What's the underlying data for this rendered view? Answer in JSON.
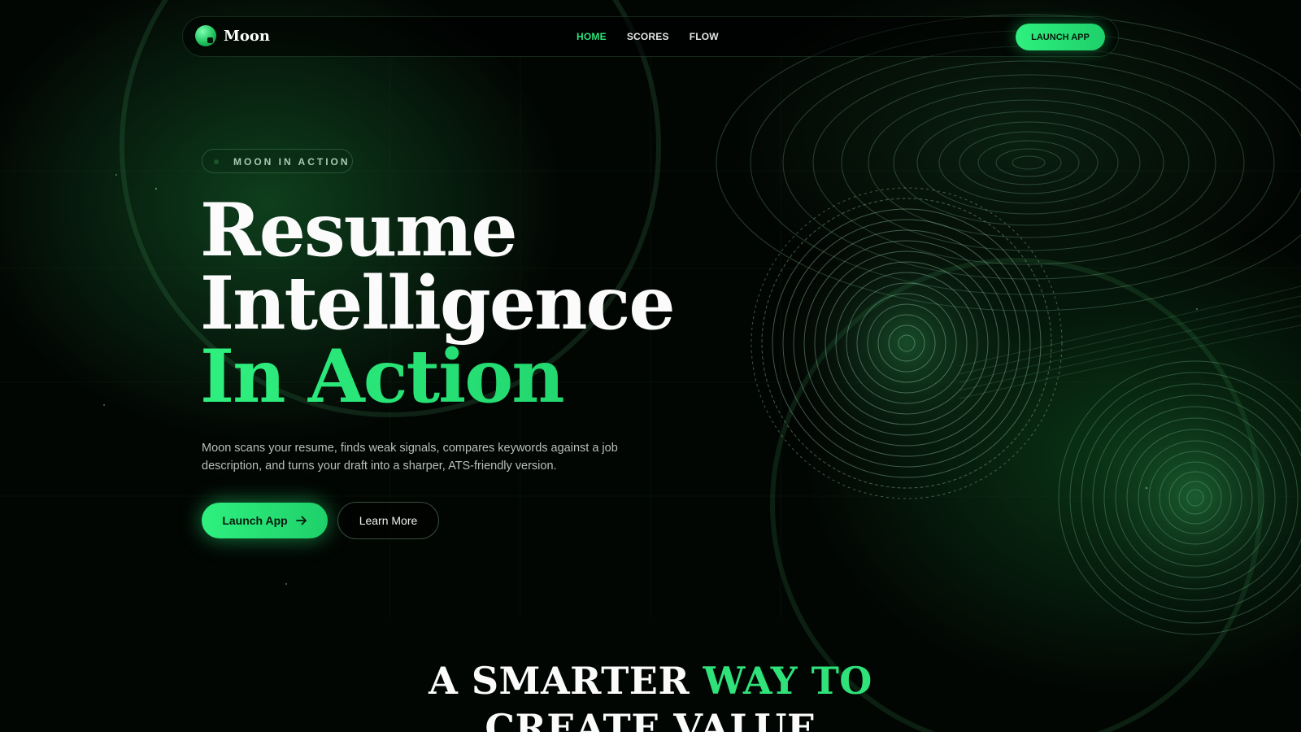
{
  "brand": {
    "name": "Moon",
    "accent": "#2fe27a"
  },
  "nav": {
    "links": [
      {
        "label": "HOME",
        "active": true
      },
      {
        "label": "SCORES",
        "active": false
      },
      {
        "label": "FLOW",
        "active": false
      }
    ],
    "cta_label": "LAUNCH APP"
  },
  "hero": {
    "badge": "MOON IN ACTION",
    "title_line1": "Resume",
    "title_line2": "Intelligence",
    "title_line3": "In Action",
    "description": "Moon scans your resume, finds weak signals, compares keywords against a job description, and turns your draft into a sharper, ATS-friendly version.",
    "primary_button": "Launch App",
    "secondary_button": "Learn More",
    "arrow_icon": "arrow-right-icon"
  },
  "section": {
    "title_part1": "A SMARTER ",
    "title_part2": "WAY TO",
    "title_line2": "CREATE VALUE"
  }
}
